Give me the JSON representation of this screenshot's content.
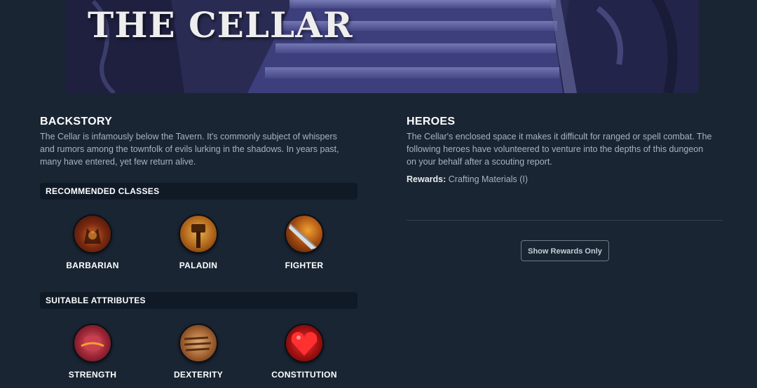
{
  "banner": {
    "title": "THE CELLAR"
  },
  "backstory": {
    "heading": "BACKSTORY",
    "lines": [
      "The Cellar is infamously below the Tavern. It's commonly subject of whispers",
      "and rumors among the townfolk of evils lurking in the shadows. In years past,",
      "many have entered, yet few return alive."
    ]
  },
  "recommended_classes": {
    "heading": "RECOMMENDED CLASSES",
    "items": [
      {
        "label": "BARBARIAN",
        "icon": "barbarian-icon"
      },
      {
        "label": "PALADIN",
        "icon": "paladin-icon"
      },
      {
        "label": "FIGHTER",
        "icon": "fighter-icon"
      }
    ]
  },
  "suitable_attributes": {
    "heading": "SUITABLE ATTRIBUTES",
    "items": [
      {
        "label": "STRENGTH",
        "icon": "strength-icon"
      },
      {
        "label": "DEXTERITY",
        "icon": "dexterity-icon"
      },
      {
        "label": "CONSTITUTION",
        "icon": "constitution-icon"
      }
    ]
  },
  "heroes": {
    "heading": "HEROES",
    "lines": [
      "The Cellar's enclosed space it makes it difficult for ranged or spell combat. The",
      "following heroes have volunteered to venture into the depths of this dungeon",
      "on your behalf after a scouting report."
    ],
    "rewards_label": "Rewards:",
    "rewards_value": "Crafting Materials (I)",
    "button_label": "Show Rewards Only"
  }
}
